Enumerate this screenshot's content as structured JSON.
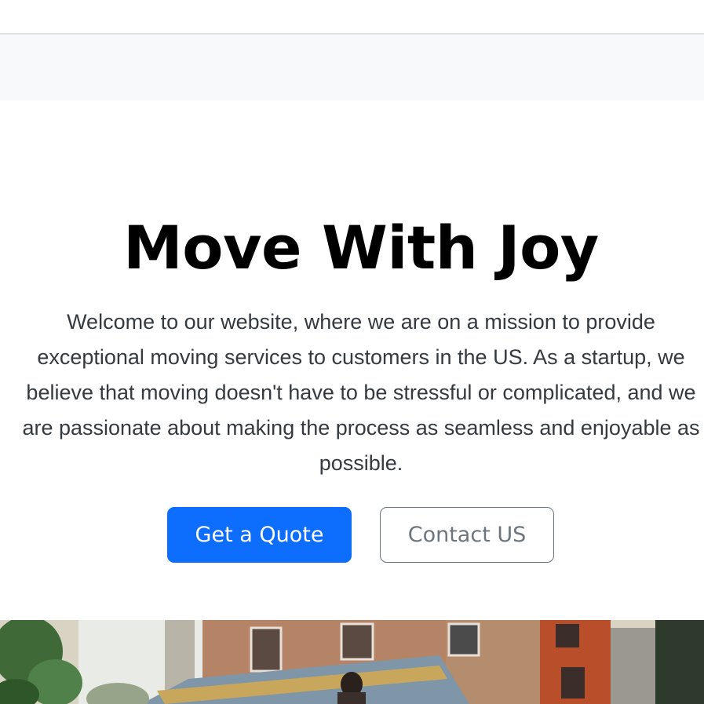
{
  "hero": {
    "title": "Move With Joy",
    "lead": "Welcome to our website, where we are on a mission to provide\nexceptional moving services to customers in the US. As a startup, we\nbelieve that moving doesn't have to be stressful or complicated, and we\nare passionate about making the process as seamless and enjoyable as\npossible.",
    "primary_button": "Get a Quote",
    "secondary_button": "Contact US"
  },
  "colors": {
    "primary": "#0d6efd",
    "secondary": "#6c757d",
    "light_bg": "#f8f9fa"
  }
}
